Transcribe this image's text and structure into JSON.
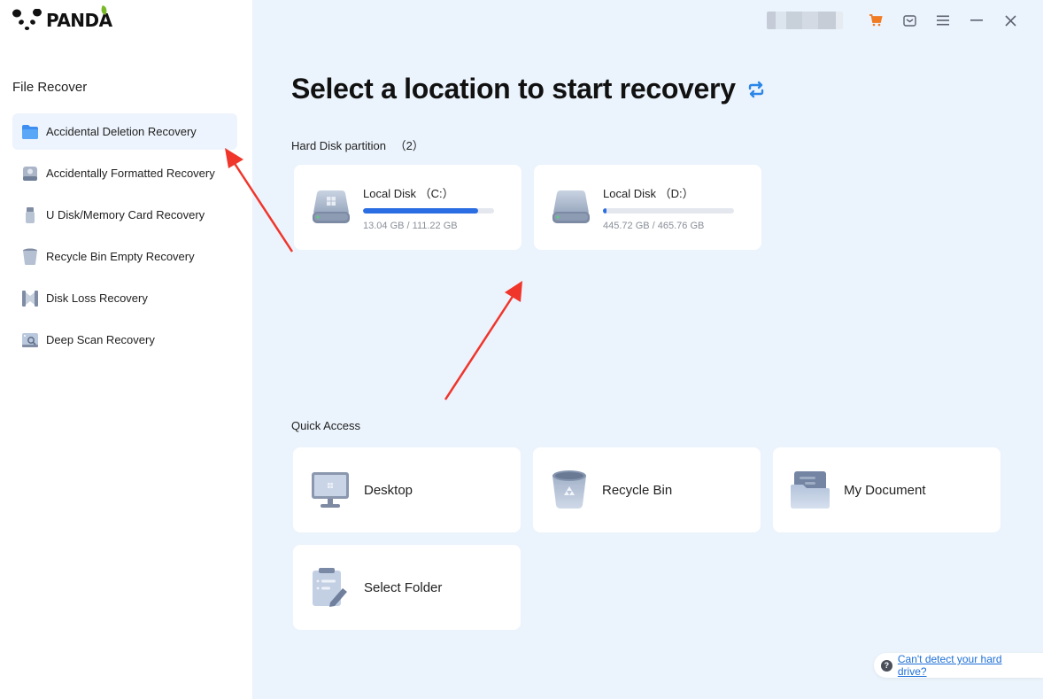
{
  "app": {
    "logo_text": "PANDA"
  },
  "sidebar": {
    "section_title": "File Recover",
    "items": [
      {
        "label": "Accidental Deletion Recovery",
        "icon": "folder-icon",
        "active": true
      },
      {
        "label": "Accidentally Formatted Recovery",
        "icon": "drive-icon",
        "active": false
      },
      {
        "label": "U Disk/Memory Card Recovery",
        "icon": "usb-icon",
        "active": false
      },
      {
        "label": "Recycle Bin Empty Recovery",
        "icon": "trash-icon",
        "active": false
      },
      {
        "label": "Disk Loss Recovery",
        "icon": "disk-loss-icon",
        "active": false
      },
      {
        "label": "Deep Scan Recovery",
        "icon": "deep-scan-icon",
        "active": false
      }
    ]
  },
  "topbar": {
    "icons": [
      "cart-icon",
      "message-icon",
      "menu-icon",
      "minimize-icon",
      "close-icon"
    ],
    "cart_color": "#f07b22"
  },
  "main": {
    "title": "Select a location to start recovery",
    "refresh_icon": "refresh-icon",
    "partitions_label": "Hard Disk partition",
    "partitions_count": "（2）",
    "disks": [
      {
        "name": "Local Disk （C:）",
        "usage": "13.04 GB / 111.22 GB",
        "fill_percent": 88
      },
      {
        "name": "Local Disk （D:）",
        "usage": "445.72 GB / 465.76 GB",
        "fill_percent": 3
      }
    ],
    "quick_access_label": "Quick Access",
    "quick_access": [
      {
        "label": "Desktop",
        "icon": "desktop-icon"
      },
      {
        "label": "Recycle Bin",
        "icon": "recycle-bin-icon"
      },
      {
        "label": "My Document",
        "icon": "document-folder-icon"
      },
      {
        "label": "Select Folder",
        "icon": "select-folder-icon"
      }
    ]
  },
  "help": {
    "link_text": "Can't detect your hard drive?"
  },
  "colors": {
    "accent": "#2b6de2",
    "background": "#ebf3fc",
    "annotation_arrow": "#f0352b"
  }
}
